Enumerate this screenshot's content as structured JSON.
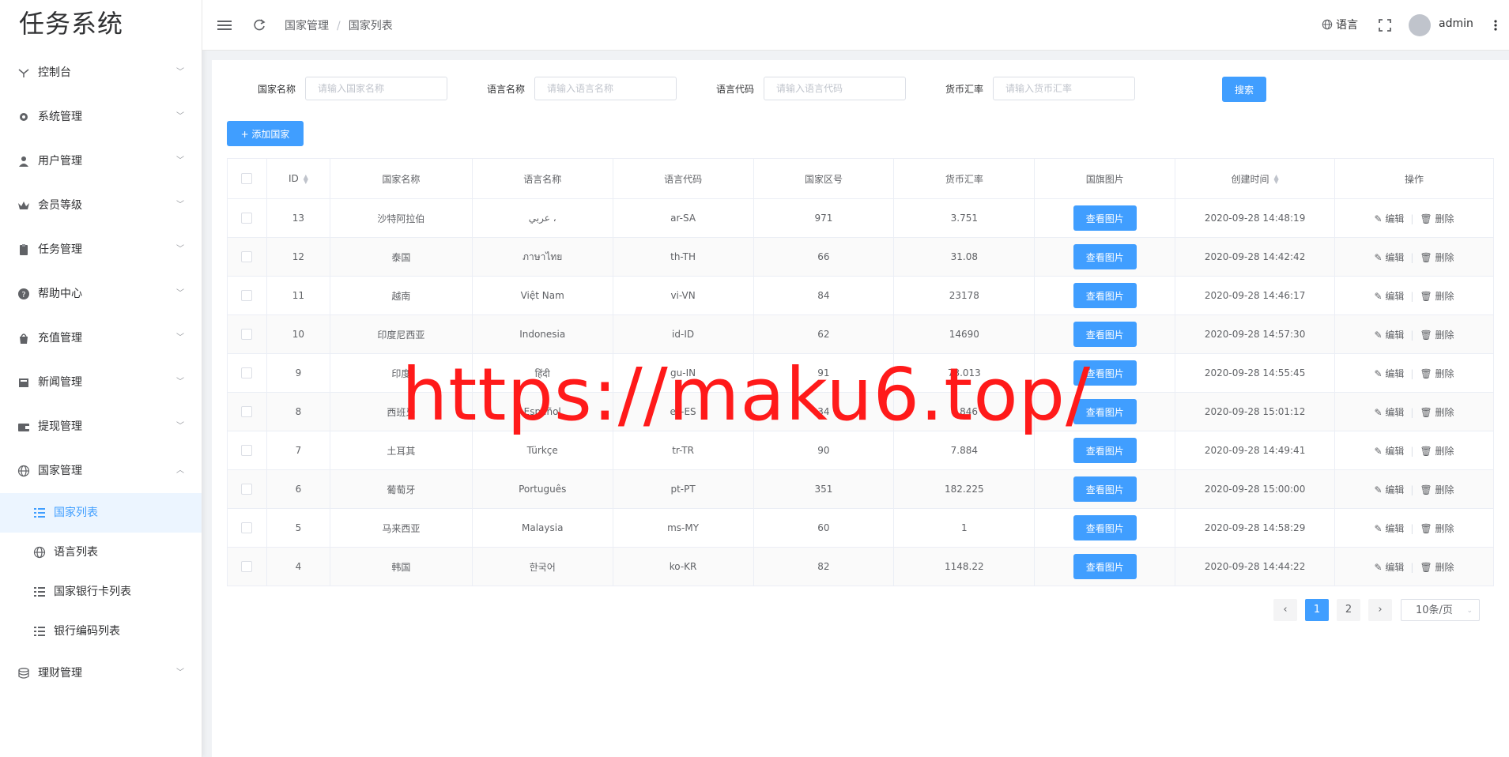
{
  "app": {
    "title": "任务系统"
  },
  "sidebar": {
    "items": [
      {
        "label": "控制台",
        "icon": "dashboard-icon",
        "expanded": false
      },
      {
        "label": "系统管理",
        "icon": "gear-icon",
        "expanded": false
      },
      {
        "label": "用户管理",
        "icon": "user-icon",
        "expanded": false
      },
      {
        "label": "会员等级",
        "icon": "crown-icon",
        "expanded": false
      },
      {
        "label": "任务管理",
        "icon": "clipboard-icon",
        "expanded": false
      },
      {
        "label": "帮助中心",
        "icon": "help-icon",
        "expanded": false
      },
      {
        "label": "充值管理",
        "icon": "bag-icon",
        "expanded": false
      },
      {
        "label": "新闻管理",
        "icon": "news-icon",
        "expanded": false
      },
      {
        "label": "提现管理",
        "icon": "wallet-icon",
        "expanded": false
      },
      {
        "label": "国家管理",
        "icon": "globe-icon",
        "expanded": true
      },
      {
        "label": "理财管理",
        "icon": "database-icon",
        "expanded": false
      }
    ],
    "sub_items": [
      {
        "label": "国家列表",
        "icon": "list-icon",
        "active": true
      },
      {
        "label": "语言列表",
        "icon": "globe-icon",
        "active": false
      },
      {
        "label": "国家银行卡列表",
        "icon": "list-icon",
        "active": false
      },
      {
        "label": "银行编码列表",
        "icon": "list-icon",
        "active": false
      }
    ]
  },
  "header": {
    "breadcrumb": [
      "国家管理",
      "国家列表"
    ],
    "separator": "/",
    "language_label": "语言",
    "username": "admin"
  },
  "filters": {
    "country_name": {
      "label": "国家名称",
      "placeholder": "请输入国家名称"
    },
    "language_name": {
      "label": "语言名称",
      "placeholder": "请输入语言名称"
    },
    "language_code": {
      "label": "语言代码",
      "placeholder": "请输入语言代码"
    },
    "exchange_rate": {
      "label": "货币汇率",
      "placeholder": "请输入货币汇率"
    },
    "search_label": "搜索"
  },
  "toolbar": {
    "add_label": "+ 添加国家"
  },
  "table": {
    "columns": [
      "ID",
      "国家名称",
      "语言名称",
      "语言代码",
      "国家区号",
      "货币汇率",
      "国旗图片",
      "创建时间",
      "操作"
    ],
    "view_label": "查看图片",
    "edit_label": "编辑",
    "delete_label": "删除",
    "rows": [
      {
        "id": "13",
        "country": "沙特阿拉伯",
        "language": "عربي ،",
        "code": "ar-SA",
        "dial": "971",
        "rate": "3.751",
        "created": "2020-09-28 14:48:19"
      },
      {
        "id": "12",
        "country": "泰国",
        "language": "ภาษาไทย",
        "code": "th-TH",
        "dial": "66",
        "rate": "31.08",
        "created": "2020-09-28 14:42:42"
      },
      {
        "id": "11",
        "country": "越南",
        "language": "Việt Nam",
        "code": "vi-VN",
        "dial": "84",
        "rate": "23178",
        "created": "2020-09-28 14:46:17"
      },
      {
        "id": "10",
        "country": "印度尼西亚",
        "language": "Indonesia",
        "code": "id-ID",
        "dial": "62",
        "rate": "14690",
        "created": "2020-09-28 14:57:30"
      },
      {
        "id": "9",
        "country": "印度",
        "language": "हिंदी",
        "code": "gu-IN",
        "dial": "91",
        "rate": "73.013",
        "created": "2020-09-28 14:55:45"
      },
      {
        "id": "8",
        "country": "西班牙",
        "language": "Español",
        "code": "es-ES",
        "dial": "34",
        "rate": "0.846",
        "created": "2020-09-28 15:01:12"
      },
      {
        "id": "7",
        "country": "土耳其",
        "language": "Türkçe",
        "code": "tr-TR",
        "dial": "90",
        "rate": "7.884",
        "created": "2020-09-28 14:49:41"
      },
      {
        "id": "6",
        "country": "葡萄牙",
        "language": "Português",
        "code": "pt-PT",
        "dial": "351",
        "rate": "182.225",
        "created": "2020-09-28 15:00:00"
      },
      {
        "id": "5",
        "country": "马来西亚",
        "language": "Malaysia",
        "code": "ms-MY",
        "dial": "60",
        "rate": "1",
        "created": "2020-09-28 14:58:29"
      },
      {
        "id": "4",
        "country": "韩国",
        "language": "한국어",
        "code": "ko-KR",
        "dial": "82",
        "rate": "1148.22",
        "created": "2020-09-28 14:44:22"
      }
    ]
  },
  "pagination": {
    "pages": [
      "1",
      "2"
    ],
    "current": "1",
    "page_size": "10条/页"
  },
  "watermark": "https://maku6.top/",
  "colors": {
    "primary": "#409eff",
    "watermark": "#ff1a1a"
  }
}
